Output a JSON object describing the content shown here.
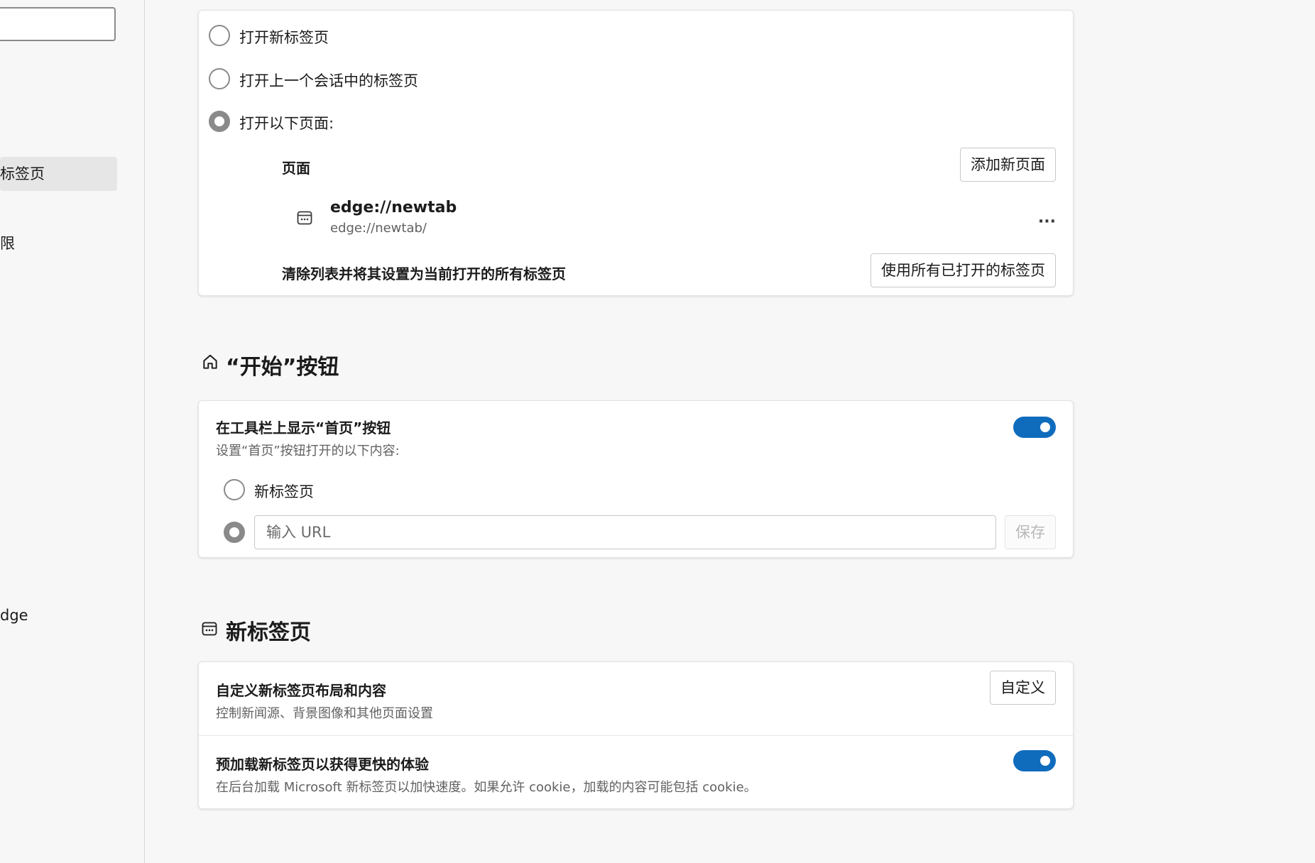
{
  "sidebar": {
    "items": [
      {
        "label": "标签页",
        "active": true
      },
      {
        "label": "限",
        "active": false
      },
      {
        "label": "dge",
        "active": false
      }
    ]
  },
  "startup": {
    "options": [
      {
        "label": "打开新标签页",
        "checked": false
      },
      {
        "label": "打开上一个会话中的标签页",
        "checked": false
      },
      {
        "label": "打开以下页面:",
        "checked": true
      }
    ],
    "pages_header": "页面",
    "add_page_label": "添加新页面",
    "page_entry": {
      "title": "edge://newtab",
      "url": "edge://newtab/",
      "more": "···"
    },
    "clear_label": "清除列表并将其设置为当前打开的所有标签页",
    "use_all_tabs_label": "使用所有已打开的标签页"
  },
  "home_section": {
    "heading": "“开始”按钮",
    "show_home_title": "在工具栏上显示“首页”按钮",
    "show_home_sub": "设置“首页”按钮打开的以下内容:",
    "toggle_on": true,
    "option_newtab": "新标签页",
    "url_placeholder": "输入 URL",
    "save_label": "保存"
  },
  "newtab_section": {
    "heading": "新标签页",
    "customize_title": "自定义新标签页布局和内容",
    "customize_sub": "控制新闻源、背景图像和其他页面设置",
    "customize_button": "自定义",
    "preload_title": "预加载新标签页以获得更快的体验",
    "preload_sub": "在后台加载 Microsoft 新标签页以加快速度。如果允许 cookie，加载的内容可能包括 cookie。",
    "preload_toggle_on": true
  },
  "colors": {
    "accent": "#0f6cbd",
    "radio": "#8a8a8a",
    "text": "#1b1b1b",
    "muted": "#616161"
  }
}
